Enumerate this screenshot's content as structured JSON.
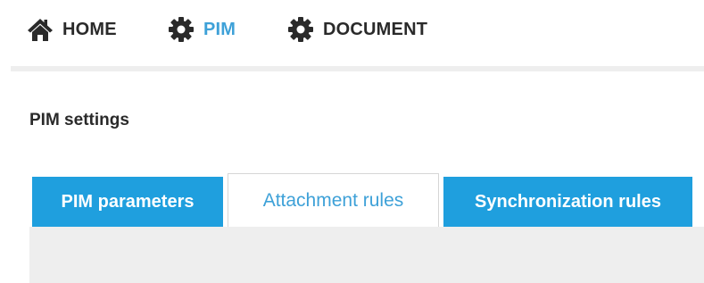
{
  "nav": {
    "items": [
      {
        "label": "HOME",
        "icon": "home-icon",
        "active": false
      },
      {
        "label": "PIM",
        "icon": "gear-icon",
        "active": true
      },
      {
        "label": "DOCUMENT",
        "icon": "gear-icon",
        "active": false
      }
    ],
    "active_color": "#3ea1d8"
  },
  "page": {
    "title": "PIM settings"
  },
  "tabs": {
    "items": [
      {
        "label": "PIM parameters",
        "active": false
      },
      {
        "label": "Attachment rules",
        "active": true
      },
      {
        "label": "Synchronization rules",
        "active": false
      }
    ],
    "tab_color": "#1f9fde",
    "active_text_color": "#3ea1d8"
  }
}
